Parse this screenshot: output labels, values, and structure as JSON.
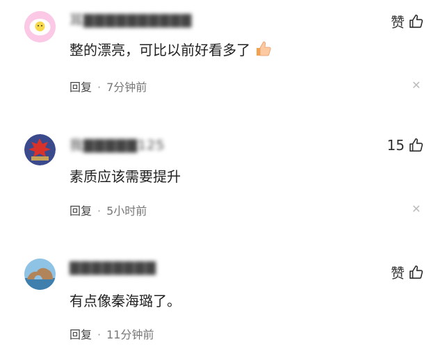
{
  "comments": [
    {
      "avatar": "egg-avatar-icon",
      "username": "耳▇▇▇▇▇▇▇▇▇▇",
      "text": "整的漂亮，可比以前好看多了",
      "emoji": "thumbs-up-emoji-icon",
      "reply_label": "回复",
      "time": "7分钟前",
      "like_label": "赞"
    },
    {
      "avatar": "autumn-leaves-avatar-icon",
      "username": "我▇▇▇▇▇125",
      "text": "素质应该需要提升",
      "reply_label": "回复",
      "time": "5小时前",
      "like_label": "15"
    },
    {
      "avatar": "seaside-rock-avatar-icon",
      "username": "▇▇▇▇▇▇▇▇",
      "text": "有点像秦海璐了。",
      "reply_label": "回复",
      "time": "11分钟前",
      "like_label": "赞"
    }
  ],
  "colors": {
    "text": "#222222",
    "meta": "#777777",
    "close": "#bbbbbb"
  }
}
